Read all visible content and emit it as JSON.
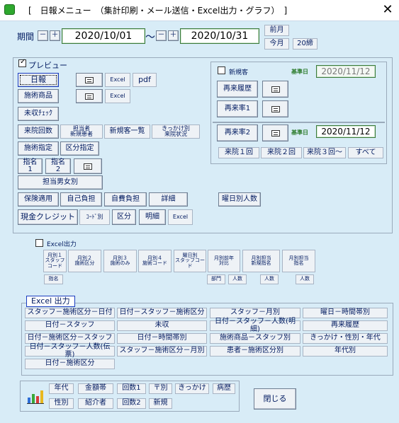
{
  "window": {
    "title": "[　日報メニュー　（集計印刷・メール送信・Excel出力・グラフ）　]",
    "close_glyph": "✕"
  },
  "period": {
    "label": "期間",
    "minus": "－",
    "plus": "＋",
    "start": "2020/10/01",
    "tilde": "～",
    "end": "2020/10/31",
    "prev_month": "前月",
    "this_month": "今月",
    "day20": "20締"
  },
  "preview": {
    "label": "プレビュー",
    "checked": true,
    "daily_report": "日報",
    "excel": "Excel",
    "pdf": "pdf",
    "treatment_product": "施術商品",
    "unpaid_check": "未収ﾁｪｯｸ",
    "visit_count": "来院回数",
    "staff_new": "担当者\n新規患者",
    "new_customer_list": "新規客一覧",
    "trigger_visit": "きっかけ別\n来院状況",
    "treatment_designation": "施術指定",
    "category_designation": "区分指定",
    "designation1": "指名\n1",
    "designation2": "指名\n2",
    "staff_gender": "担当男女別",
    "insurance": "保険適用",
    "self_pay": "自己負担",
    "own_expense": "自費負担",
    "detail": "詳細",
    "weekday_count": "曜日別人数",
    "cash_credit": "現金クレジット",
    "code_by": "ｺｰﾄﾞ別",
    "category": "区分",
    "breakdown": "明細",
    "excel2": "Excel"
  },
  "new_customer": {
    "label": "新規客",
    "checked": false,
    "base_date_label": "基準日",
    "base_date": "2020/11/12",
    "revisit_history": "再来履歴",
    "revisit_rate1": "再来率1",
    "revisit_rate2": "再来率2",
    "base_date_label2": "基準日",
    "base_date2": "2020/11/12",
    "visit1": "来院１回",
    "visit2": "来院２回",
    "visit3": "来院３回～",
    "all": "すべて"
  },
  "excel_output": {
    "label": "Excel出力",
    "checked": false,
    "buttons": [
      "月別１\nスタッフコード",
      "月別２\n施術区分",
      "月別３\n施術のみ",
      "月別４\n施術コード",
      "曜日別\nスタッフコード",
      "月別前年\n対比",
      "月別担当\n新規指名",
      "月別担当\n指名"
    ],
    "designation": "指名",
    "department": "部門",
    "people1": "人数",
    "people2": "人数",
    "people3": "人数"
  },
  "excel_section": {
    "tab": "Excel 出力",
    "rows": [
      [
        "スタッフ－施術区分－日付",
        "日付－スタッフ－施術区分",
        "スタッフ－月別",
        "曜日－時間帯別"
      ],
      [
        "日付－スタッフ",
        "未収",
        "日付－スタッフ－人数(明細)",
        "再来履歴"
      ],
      [
        "日付－施術区分－スタッフ",
        "日付－時間帯別",
        "施術商品－スタッフ別",
        "きっかけ・性別・年代"
      ],
      [
        "日付－スタッフ－人数(伝票)",
        "スタッフ－施術区分－月別",
        "患者－施術区分別",
        "年代別"
      ],
      [
        "日付－施術区分"
      ]
    ]
  },
  "graph": {
    "row1": [
      "年代",
      "金額帯",
      "回数1",
      "〒別",
      "きっかけ",
      "病歴"
    ],
    "row2": [
      "性別",
      "紹介者",
      "回数2",
      "新規"
    ],
    "close": "閉じる"
  }
}
